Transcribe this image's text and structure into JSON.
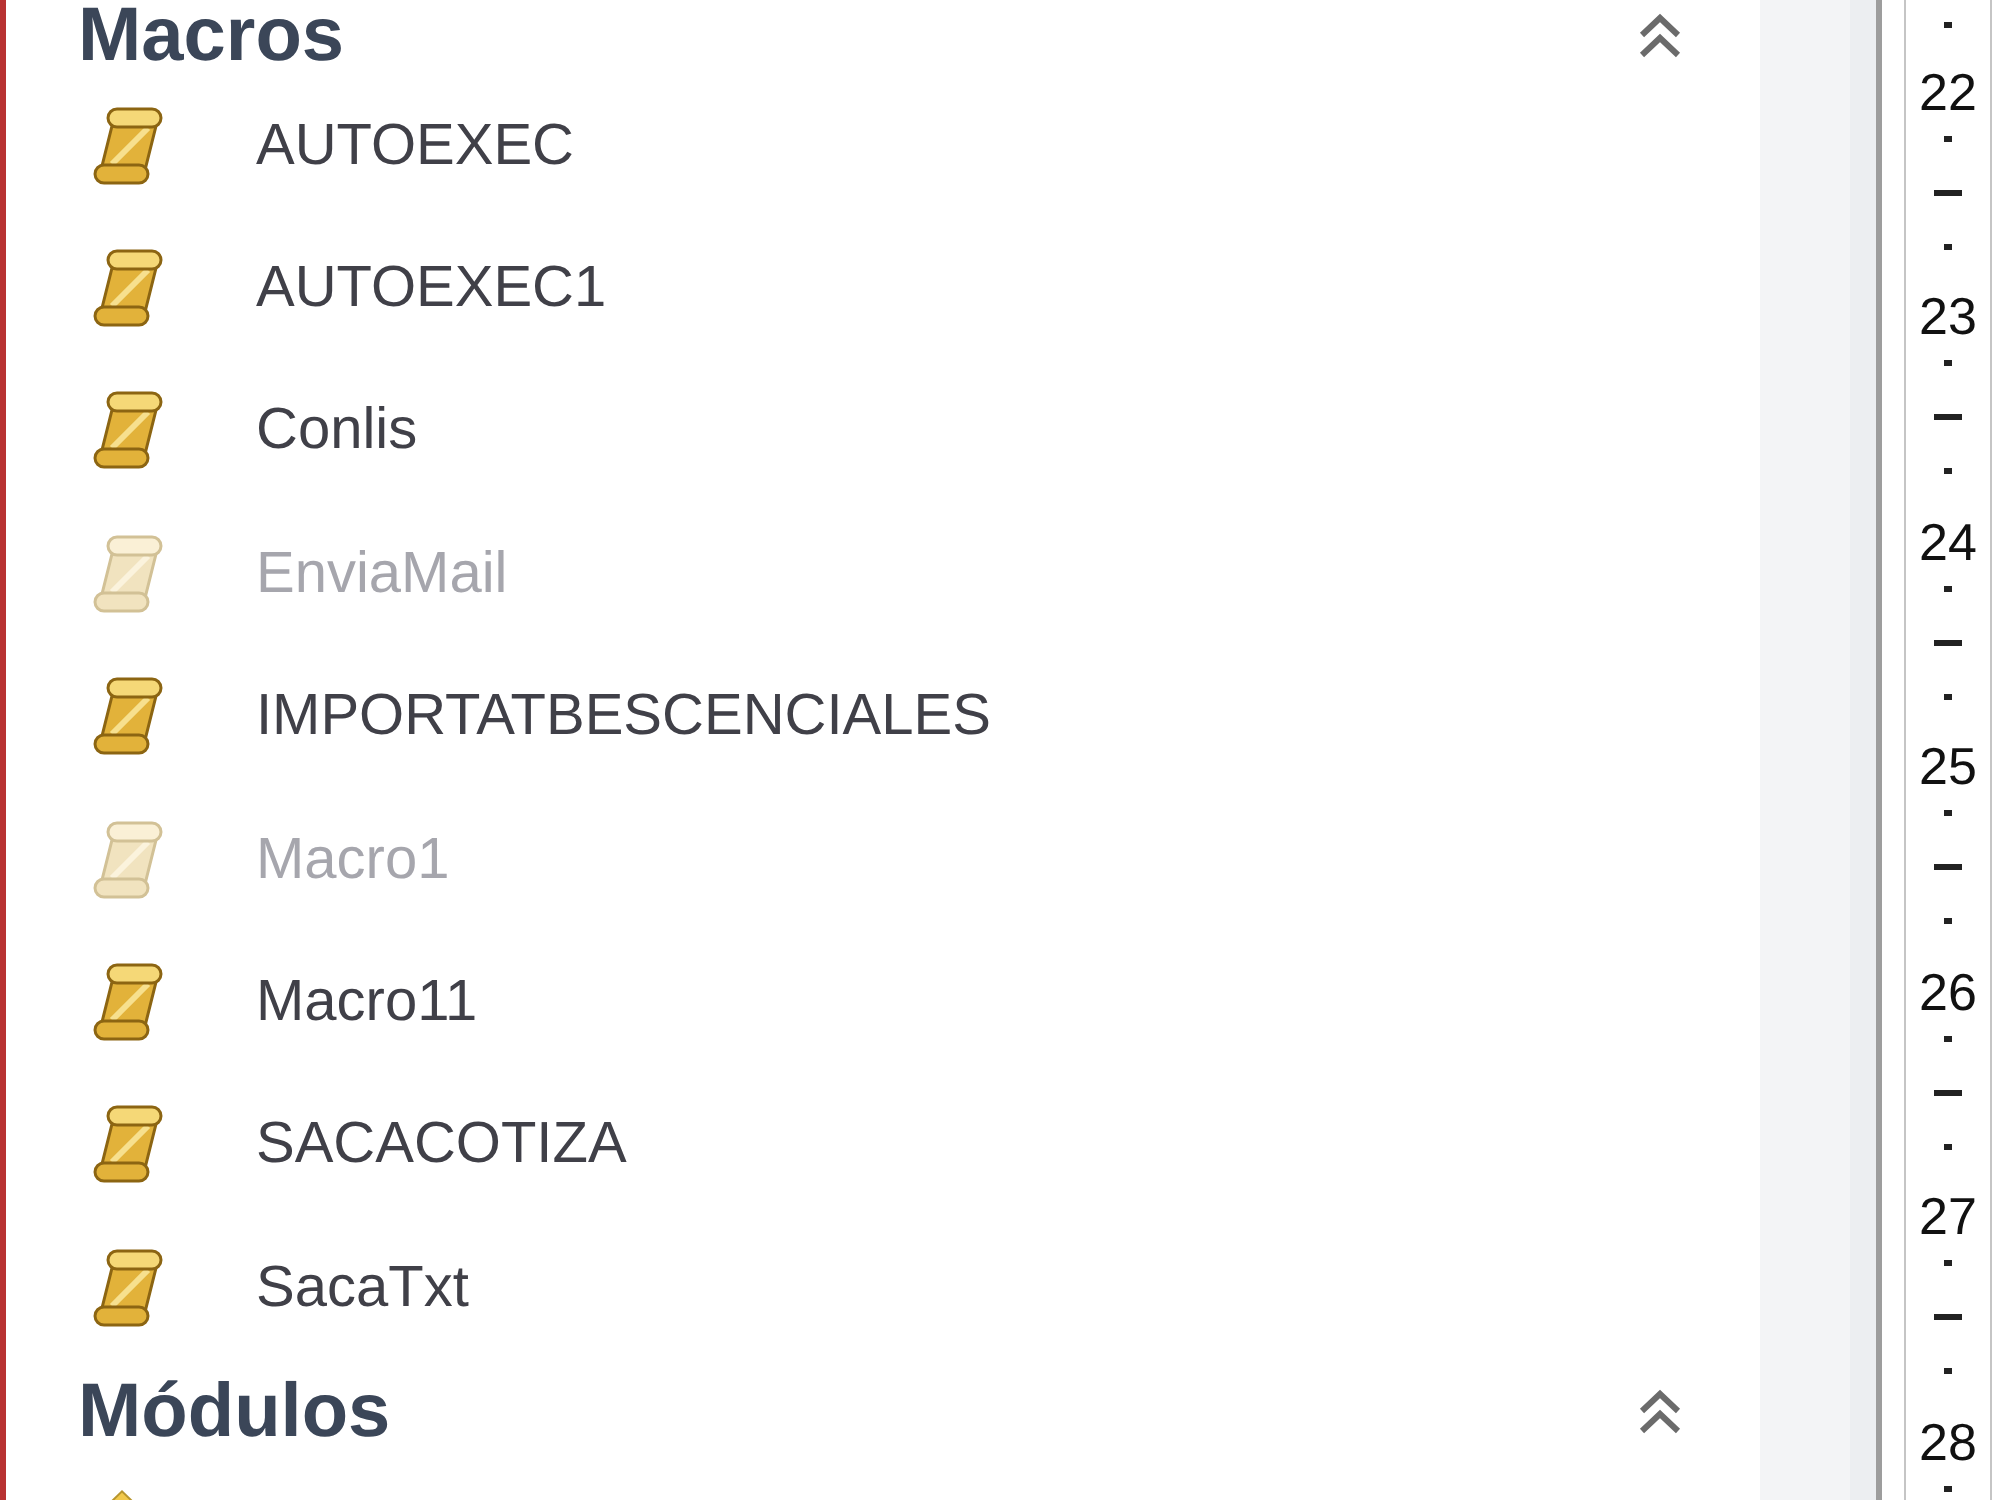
{
  "navigation_pane": {
    "sections": [
      {
        "title": "Macros",
        "expanded": true,
        "items": [
          {
            "name": "AUTOEXEC",
            "disabled": false
          },
          {
            "name": "AUTOEXEC1",
            "disabled": false
          },
          {
            "name": "Conlis",
            "disabled": false
          },
          {
            "name": "EnviaMail",
            "disabled": true
          },
          {
            "name": "IMPORTATBESCENCIALES",
            "disabled": false
          },
          {
            "name": "Macro1",
            "disabled": true
          },
          {
            "name": "Macro11",
            "disabled": false
          },
          {
            "name": "SACACOTIZA",
            "disabled": false
          },
          {
            "name": "SacaTxt",
            "disabled": false
          }
        ]
      },
      {
        "title": "Módulos",
        "expanded": true
      }
    ]
  },
  "ruler": {
    "labels": [
      "22",
      "23",
      "24",
      "25",
      "26",
      "27",
      "28"
    ]
  }
}
